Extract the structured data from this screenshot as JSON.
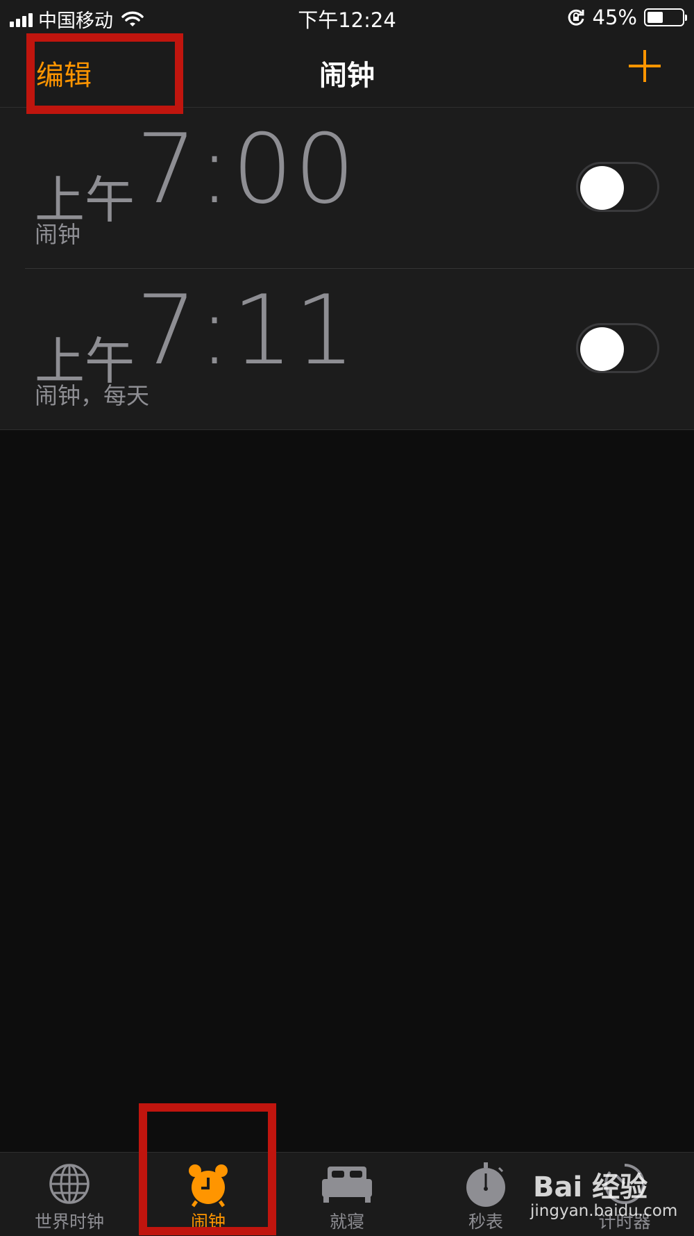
{
  "status_bar": {
    "carrier": "中国移动",
    "time": "下午12:24",
    "battery_percent": "45%",
    "battery_level": 0.45
  },
  "nav": {
    "edit_label": "编辑",
    "title": "闹钟",
    "add_icon": "plus-icon",
    "accent_color": "#ff9500"
  },
  "alarms": [
    {
      "ampm": "上午",
      "time": "7:00",
      "label": "闹钟",
      "enabled": false
    },
    {
      "ampm": "上午",
      "time": "7:11",
      "label": "闹钟，每天",
      "enabled": false
    }
  ],
  "tabs": [
    {
      "label": "世界时钟",
      "icon": "globe-icon",
      "active": false
    },
    {
      "label": "闹钟",
      "icon": "alarm-clock-icon",
      "active": true
    },
    {
      "label": "就寝",
      "icon": "bed-icon",
      "active": false
    },
    {
      "label": "秒表",
      "icon": "stopwatch-icon",
      "active": false
    },
    {
      "label": "计时器",
      "icon": "timer-icon",
      "active": false
    }
  ],
  "watermark": {
    "logo": "Bai 经验",
    "url": "jingyan.baidu.com"
  },
  "colors": {
    "highlight": "#c0150e",
    "inactive": "#8e8e93"
  }
}
